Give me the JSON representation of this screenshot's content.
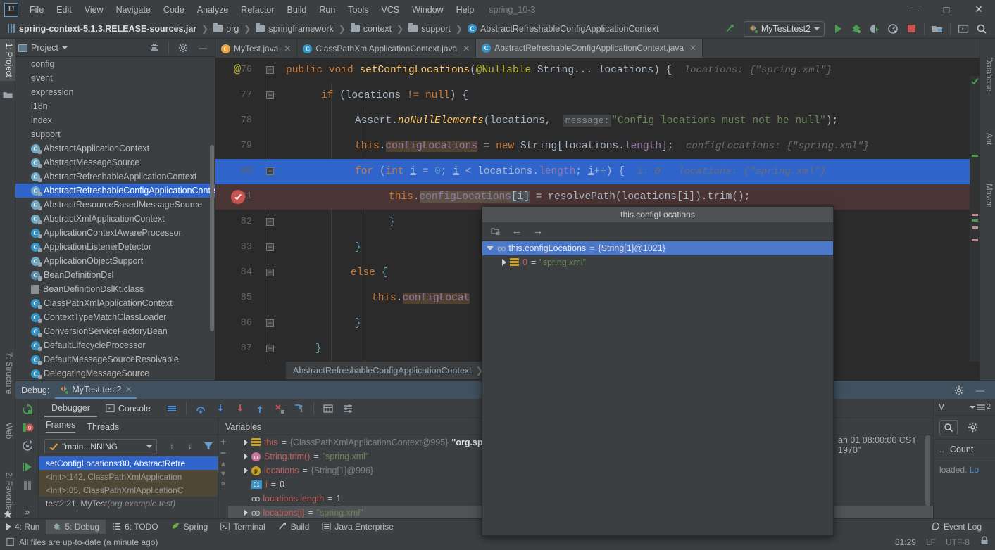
{
  "window": {
    "project_name": "spring_10-3",
    "minimize": "–",
    "maximize": "☐",
    "close": "✕"
  },
  "menu": {
    "items": [
      "File",
      "Edit",
      "View",
      "Navigate",
      "Code",
      "Analyze",
      "Refactor",
      "Build",
      "Run",
      "Tools",
      "VCS",
      "Window",
      "Help"
    ]
  },
  "breadcrumbs": [
    {
      "label": "spring-context-5.1.3.RELEASE-sources.jar",
      "icon": "jar-icon"
    },
    {
      "label": "org",
      "icon": "folder-icon"
    },
    {
      "label": "springframework",
      "icon": "folder-icon"
    },
    {
      "label": "context",
      "icon": "folder-icon"
    },
    {
      "label": "support",
      "icon": "folder-icon"
    },
    {
      "label": "AbstractRefreshableConfigApplicationContext",
      "icon": "class-icon"
    }
  ],
  "toolbar": {
    "run_config": "MyTest.test2",
    "icons": [
      "build-icon",
      "run-icon",
      "debug-icon",
      "run-coverage-icon",
      "profile-icon",
      "stop-icon",
      "project-structure-icon",
      "terminal-icon",
      "search-everywhere-icon"
    ]
  },
  "left_rail": [
    {
      "label": "1: Project",
      "active": true
    },
    {
      "label": "7: Structure",
      "active": false
    },
    {
      "label": "Web",
      "active": false
    },
    {
      "label": "2: Favorites",
      "active": false
    }
  ],
  "right_rail": [
    {
      "label": "Database"
    },
    {
      "label": "Ant"
    },
    {
      "label": "Maven"
    }
  ],
  "project_panel": {
    "title": "Project",
    "tree": [
      {
        "label": "config",
        "icon": "folder-icon",
        "selected": false
      },
      {
        "label": "event",
        "icon": "folder-icon",
        "selected": false
      },
      {
        "label": "expression",
        "icon": "folder-icon",
        "selected": false
      },
      {
        "label": "i18n",
        "icon": "folder-icon",
        "selected": false
      },
      {
        "label": "index",
        "icon": "folder-icon",
        "selected": false
      },
      {
        "label": "support",
        "icon": "folder-icon",
        "selected": false
      },
      {
        "label": "AbstractApplicationContext",
        "icon": "abstract-class-icon",
        "selected": false
      },
      {
        "label": "AbstractMessageSource",
        "icon": "abstract-class-icon",
        "selected": false
      },
      {
        "label": "AbstractRefreshableApplicationContext",
        "icon": "abstract-class-icon",
        "selected": false
      },
      {
        "label": "AbstractRefreshableConfigApplicationContext",
        "icon": "abstract-class-icon",
        "selected": true
      },
      {
        "label": "AbstractResourceBasedMessageSource",
        "icon": "abstract-class-icon",
        "selected": false
      },
      {
        "label": "AbstractXmlApplicationContext",
        "icon": "abstract-class-icon",
        "selected": false
      },
      {
        "label": "ApplicationContextAwareProcessor",
        "icon": "class-icon",
        "selected": false
      },
      {
        "label": "ApplicationListenerDetector",
        "icon": "class-icon",
        "selected": false
      },
      {
        "label": "ApplicationObjectSupport",
        "icon": "abstract-class-icon",
        "selected": false
      },
      {
        "label": "BeanDefinitionDsl",
        "icon": "kotlin-class-icon",
        "selected": false
      },
      {
        "label": "BeanDefinitionDslKt.class",
        "icon": "kotlin-file-icon",
        "selected": false
      },
      {
        "label": "ClassPathXmlApplicationContext",
        "icon": "class-icon",
        "selected": false
      },
      {
        "label": "ContextTypeMatchClassLoader",
        "icon": "class-icon",
        "selected": false
      },
      {
        "label": "ConversionServiceFactoryBean",
        "icon": "class-icon",
        "selected": false
      },
      {
        "label": "DefaultLifecycleProcessor",
        "icon": "class-icon",
        "selected": false
      },
      {
        "label": "DefaultMessageSourceResolvable",
        "icon": "class-icon",
        "selected": false
      },
      {
        "label": "DelegatingMessageSource",
        "icon": "class-icon",
        "selected": false
      }
    ]
  },
  "editor": {
    "tabs": [
      {
        "label": "MyTest.java",
        "icon": "java-test-icon",
        "active": false
      },
      {
        "label": "ClassPathXmlApplicationContext.java",
        "icon": "java-class-icon",
        "active": false
      },
      {
        "label": "AbstractRefreshableConfigApplicationContext.java",
        "icon": "java-abstract-icon",
        "active": true
      }
    ],
    "breadcrumb": "AbstractRefreshableConfigApplicationContext",
    "lines": [
      {
        "num": "76",
        "marker": "annotation-override"
      },
      {
        "num": "77"
      },
      {
        "num": "78"
      },
      {
        "num": "79"
      },
      {
        "num": "80",
        "highlight": "selected"
      },
      {
        "num": "81",
        "highlight": "executing",
        "marker": "breakpoint"
      },
      {
        "num": "82"
      },
      {
        "num": "83"
      },
      {
        "num": "84"
      },
      {
        "num": "85"
      },
      {
        "num": "86"
      },
      {
        "num": "87"
      }
    ],
    "code": {
      "l76": {
        "kw1": "public",
        "kw2": "void",
        "fn": "setConfigLocations",
        "ann": "@Nullable",
        "type": "String...",
        "arg": "locations",
        "hint": "locations: {\"spring.xml\"}"
      },
      "l77": {
        "kw": "if",
        "expr": "locations",
        "op": "!=",
        "kw2": "null"
      },
      "l78": {
        "cls": "Assert.",
        "fn": "noNullElements",
        "arg": "locations,",
        "param": "message:",
        "str": "\"Config locations must not be null\""
      },
      "l79": {
        "this": "this.",
        "fld": "configLocations",
        "eq": "=",
        "kw": "new",
        "type": "String[locations.",
        "len": "length",
        "tail": "];",
        "hint": "configLocations: {\"spring.xml\"}"
      },
      "l80": {
        "kw": "for",
        "init": "(int i = 0; i < locations.",
        "len": "length",
        "inc": "; i++) {",
        "hint": "i: 0   locations: {\"spring.xml\"}"
      },
      "l81": {
        "this": "this.",
        "fld": "configLocations",
        "idx": "[i]",
        "eq": "=",
        "call": "resolvePath(locations[i]).trim();"
      },
      "l82": {
        "text": "}"
      },
      "l83": {
        "text": "}"
      },
      "l84": {
        "kw": "else",
        "text": "{"
      },
      "l85": {
        "this": "this.",
        "fld": "configLocat"
      },
      "l86": {
        "text": "}"
      },
      "l87": {
        "text": "}"
      }
    }
  },
  "popup": {
    "title": "this.configLocations",
    "toolbar_icons": [
      "copy-value-icon",
      "back-arrow-icon",
      "forward-arrow-icon"
    ],
    "rows": [
      {
        "expander": "down",
        "icon": "array-icon",
        "name": "this.configLocations",
        "eq": "=",
        "value": "{String[1]@1021}",
        "value_kind": "ref",
        "selected": true,
        "indent": 0
      },
      {
        "expander": "right",
        "icon": "index-icon",
        "name": "0",
        "eq": "=",
        "value": "\"spring.xml\"",
        "value_kind": "string",
        "selected": false,
        "indent": 1
      }
    ]
  },
  "debug": {
    "header_label": "Debug:",
    "session_tab": "MyTest.test2",
    "tabs": [
      {
        "label": "Debugger",
        "icon": "debugger-icon",
        "active": true
      },
      {
        "label": "Console",
        "icon": "console-icon",
        "active": false
      }
    ],
    "left_buttons": [
      "rerun-icon",
      "mute-breakpoints-icon",
      "restore-layout-icon",
      "resume-icon",
      "pause-icon",
      "more-icon"
    ],
    "stepping_icons": [
      "show-execution-point-icon",
      "step-over-icon",
      "step-into-icon",
      "force-step-into-icon",
      "step-out-icon",
      "drop-frame-icon",
      "run-to-cursor-icon",
      "evaluate-expression-icon",
      "settings-icon"
    ],
    "frames": {
      "tabs": [
        {
          "label": "Frames",
          "active": true
        },
        {
          "label": "Threads",
          "active": false
        }
      ],
      "thread_selector": "\"main...NNING",
      "stack": [
        {
          "label": "setConfigLocations:80, AbstractRefre",
          "selected": true,
          "library": false,
          "suffix": ""
        },
        {
          "label": "<init>:142, ClassPathXmlApplication",
          "selected": false,
          "library": true,
          "suffix": ""
        },
        {
          "label": "<init>:85, ClassPathXmlApplicationC",
          "selected": false,
          "library": true,
          "suffix": ""
        },
        {
          "label": "test2:21, MyTest",
          "selected": false,
          "library": false,
          "suffix": "(org.example.test)"
        }
      ]
    },
    "variables": {
      "title": "Variables",
      "rows": [
        {
          "expander": "right",
          "icon": "array-icon",
          "name": "this",
          "eq": "=",
          "ref": "{ClassPathXmlApplicationContext@995}",
          "extra": "\"org.springf",
          "selected": false
        },
        {
          "expander": "right",
          "icon": "method-icon",
          "name": "String.trim()",
          "eq": "=",
          "str": "\"spring.xml\"",
          "selected": false
        },
        {
          "expander": "right",
          "icon": "param-icon",
          "name": "locations",
          "eq": "=",
          "ref": "{String[1]@996}",
          "selected": false
        },
        {
          "expander": "none",
          "icon": "primitive-icon",
          "name": "i",
          "eq": "=",
          "num": "0",
          "selected": false
        },
        {
          "expander": "none",
          "icon": "field-icon",
          "name": "locations.length",
          "eq": "=",
          "num": "1",
          "selected": false
        },
        {
          "expander": "right",
          "icon": "field-icon",
          "name": "locations[i]",
          "eq": "=",
          "str": "\"spring.xml\"",
          "selected": true
        }
      ]
    },
    "console_tail": "an 01 08:00:00 CST 1970\"",
    "watch": {
      "tab_label": "M",
      "badge": "2",
      "count_label": "Count",
      "dots": "..",
      "text": "loaded. ",
      "link": "Lo"
    }
  },
  "bottom_tabs": [
    {
      "label": "4: Run",
      "icon": "run-icon",
      "active": false
    },
    {
      "label": "5: Debug",
      "icon": "debug-icon",
      "active": true
    },
    {
      "label": "6: TODO",
      "icon": "todo-icon",
      "active": false
    },
    {
      "label": "Spring",
      "icon": "spring-icon",
      "active": false
    },
    {
      "label": "Terminal",
      "icon": "terminal-icon",
      "active": false
    },
    {
      "label": "Build",
      "icon": "build-icon",
      "active": false
    },
    {
      "label": "Java Enterprise",
      "icon": "java-enterprise-icon",
      "active": false
    }
  ],
  "event_log": {
    "label": "Event Log",
    "icon": "event-log-icon"
  },
  "status_bar": {
    "message": "All files are up-to-date (a minute ago)",
    "caret": "81:29",
    "line_sep": "LF",
    "encoding": "UTF-8",
    "lock_icon": "read-only-icon"
  },
  "colors": {
    "accent_blue": "#2f65ca",
    "selection_blue": "#4b78c8",
    "panel_bg": "#3c3f41",
    "editor_bg": "#2b2b2b",
    "exec_line": "#4b3534",
    "keyword": "#cc7832",
    "string": "#6a8759",
    "field": "#9876aa",
    "method": "#ffc66d",
    "breakpoint_red": "#c75450",
    "run_green": "#499c54"
  }
}
